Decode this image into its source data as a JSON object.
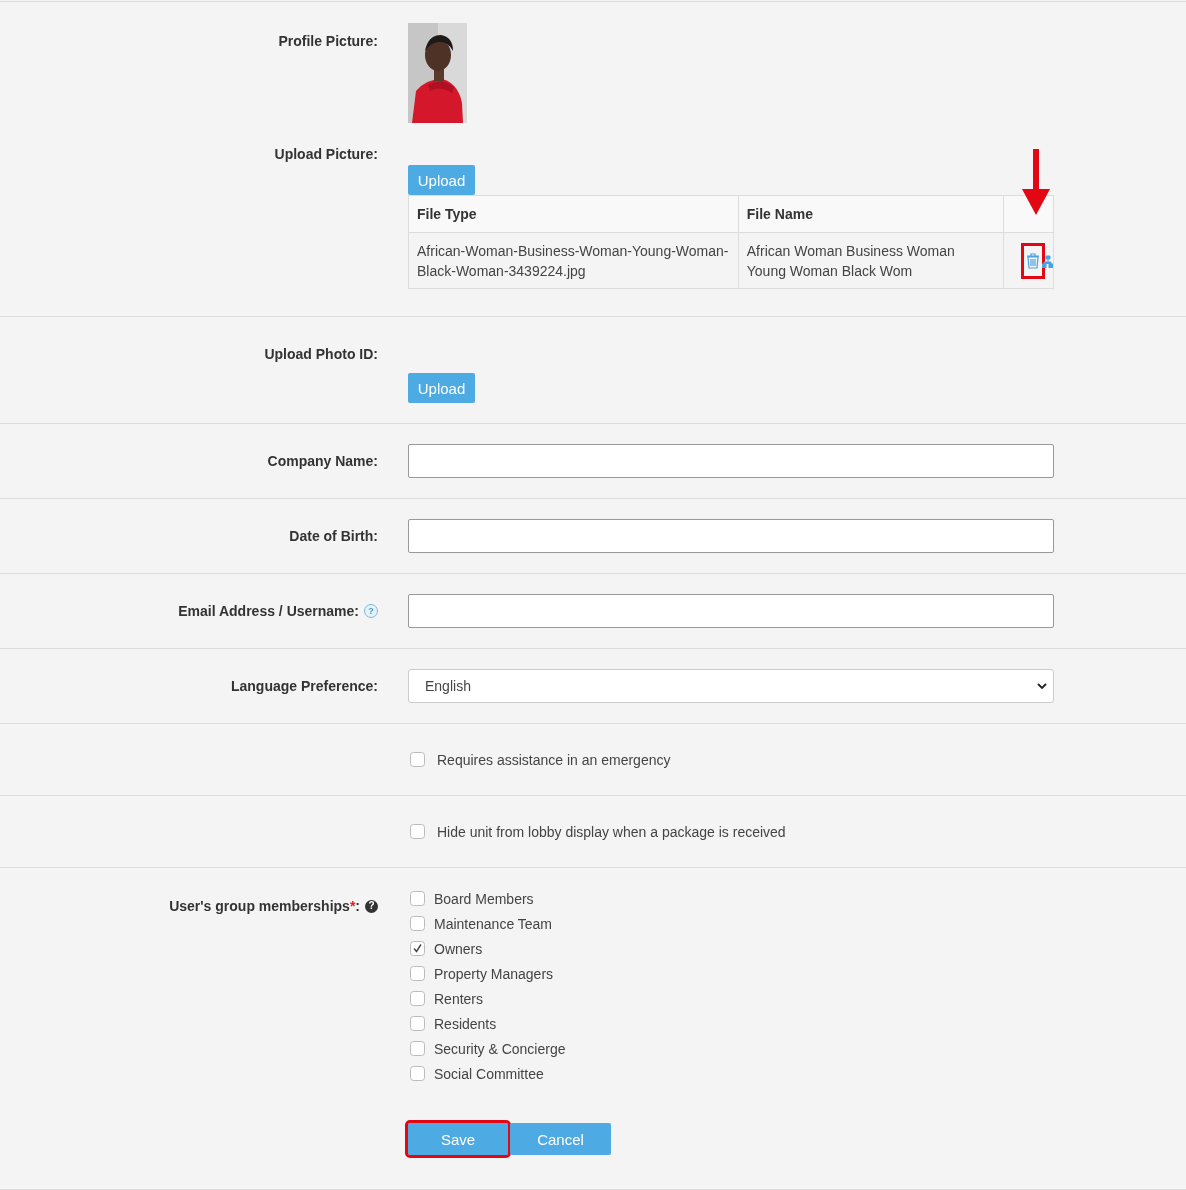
{
  "profile_picture": {
    "label": "Profile Picture:"
  },
  "upload_picture": {
    "label": "Upload Picture:",
    "button": "Upload",
    "table": {
      "columns": [
        "File Type",
        "File Name"
      ],
      "rows": [
        {
          "file_type": "African-Woman-Business-Woman-Young-Woman-Black-Woman-3439224.jpg",
          "file_name": "African Woman Business Woman Young Woman Black Wom",
          "annotated": true
        }
      ]
    }
  },
  "fields": [
    {
      "kind": "upload",
      "label": "Upload Photo ID:",
      "button": "Upload"
    },
    {
      "kind": "text",
      "label": "Company Name:"
    },
    {
      "kind": "text",
      "label": "Date of Birth:"
    },
    {
      "kind": "text",
      "label": "Email Address / Username:",
      "help": {
        "kind": "light",
        "glyph": "?"
      }
    },
    {
      "kind": "select",
      "label": "Language Preference:",
      "value": "English"
    },
    {
      "kind": "checkbox",
      "label": "Requires assistance in an emergency",
      "checked": false
    },
    {
      "kind": "checkbox",
      "label": "Hide unit from lobby display when a package is received",
      "checked": false
    },
    {
      "kind": "checklist",
      "label": "User's group memberships",
      "required_mark": "*",
      "label_suffix": ":",
      "help": {
        "kind": "dark",
        "glyph": "?"
      },
      "options": [
        {
          "label": "Board Members",
          "checked": false
        },
        {
          "label": "Maintenance Team",
          "checked": false
        },
        {
          "label": "Owners",
          "checked": true
        },
        {
          "label": "Property Managers",
          "checked": false
        },
        {
          "label": "Renters",
          "checked": false
        },
        {
          "label": "Residents",
          "checked": false
        },
        {
          "label": "Security & Concierge",
          "checked": false
        },
        {
          "label": "Social Committee",
          "checked": false
        }
      ],
      "actions": [
        {
          "label": "Save",
          "annotated": true
        },
        {
          "label": "Cancel",
          "annotated": false
        }
      ]
    }
  ]
}
